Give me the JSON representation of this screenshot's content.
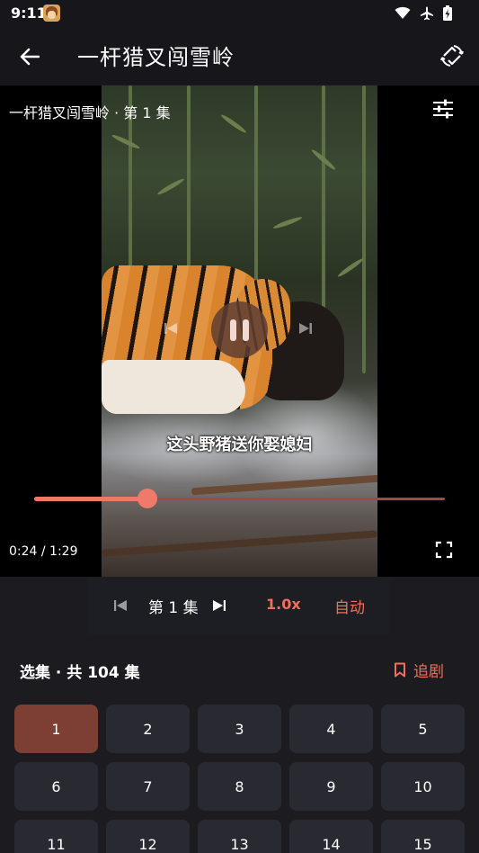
{
  "status": {
    "time": "9:11"
  },
  "appbar": {
    "title": "一杆猎叉闯雪岭"
  },
  "player": {
    "episode_label": "一杆猎叉闯雪岭 · 第 1 集",
    "subtitle": "这头野猪送你娶媳妇",
    "time_readout": "0:24 / 1:29",
    "progress_fraction": 0.276
  },
  "controls": {
    "episode": "第 1 集",
    "speed": "1.0x",
    "auto": "自动"
  },
  "panel": {
    "header": "选集 · 共 104 集",
    "follow_label": "追剧",
    "episodes": [
      "1",
      "2",
      "3",
      "4",
      "5",
      "6",
      "7",
      "8",
      "9",
      "10",
      "11",
      "12",
      "13",
      "14",
      "15"
    ],
    "active_episode": "1"
  },
  "colors": {
    "accent": "#ef6f5c",
    "active_tile": "#7d3f33",
    "tile": "#292a31",
    "background": "#1c1c20"
  },
  "icons": [
    "back-arrow-icon",
    "rotate-icon",
    "tune-icon",
    "pause-icon",
    "skip-previous-icon",
    "skip-next-icon",
    "fullscreen-icon",
    "bookmark-icon",
    "wifi-icon",
    "airplane-icon",
    "battery-icon"
  ]
}
